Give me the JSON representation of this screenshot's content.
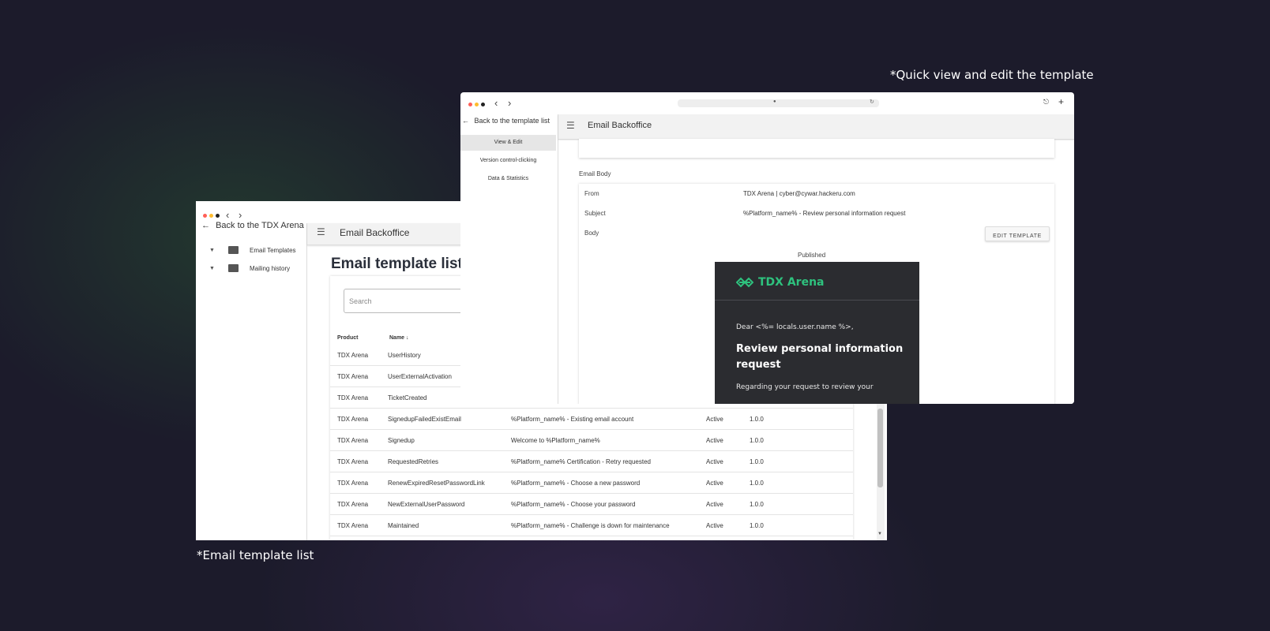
{
  "captions": {
    "quick_view": "*Quick view and edit the template",
    "template_list": "*Email template list"
  },
  "colors": {
    "background": "#1c1b2b",
    "brand_green": "#2ec27e",
    "preview_bg": "#2b2c30",
    "traffic_red": "#ff5f57",
    "traffic_yellow": "#febc2e",
    "traffic_dark": "#222222"
  },
  "list_window": {
    "back_link": "Back to the TDX Arena",
    "sidebar": [
      {
        "label": "Email Templates",
        "icon": "email-icon"
      },
      {
        "label": "Mailing history",
        "icon": "email-icon"
      }
    ],
    "appbar_title": "Email Backoffice",
    "page_title": "Email template list",
    "search_placeholder": "Search",
    "columns": {
      "product": "Product",
      "name": "Name",
      "sort_icon": "arrow-down-icon"
    },
    "rows": [
      {
        "product": "TDX Arena",
        "name": "UserHistory",
        "subject": "",
        "status": "",
        "version": ""
      },
      {
        "product": "TDX Arena",
        "name": "UserExternalActivation",
        "subject": "",
        "status": "",
        "version": ""
      },
      {
        "product": "TDX Arena",
        "name": "TicketCreated",
        "subject": "",
        "status": "",
        "version": ""
      },
      {
        "product": "TDX Arena",
        "name": "SignedupFailedExistEmail",
        "subject": "%Platform_name% - Existing email account",
        "status": "Active",
        "version": "1.0.0"
      },
      {
        "product": "TDX Arena",
        "name": "Signedup",
        "subject": "Welcome to %Platform_name%",
        "status": "Active",
        "version": "1.0.0"
      },
      {
        "product": "TDX Arena",
        "name": "RequestedRetries",
        "subject": "%Platform_name% Certification - Retry requested",
        "status": "Active",
        "version": "1.0.0"
      },
      {
        "product": "TDX Arena",
        "name": "RenewExpiredResetPasswordLink",
        "subject": "%Platform_name% - Choose a new password",
        "status": "Active",
        "version": "1.0.0"
      },
      {
        "product": "TDX Arena",
        "name": "NewExternalUserPassword",
        "subject": "%Platform_name% - Choose your password",
        "status": "Active",
        "version": "1.0.0"
      },
      {
        "product": "TDX Arena",
        "name": "Maintained",
        "subject": "%Platform_name% - Challenge is down for maintenance",
        "status": "Active",
        "version": "1.0.0"
      }
    ]
  },
  "detail_window": {
    "back_link": "Back to the template list",
    "menu": [
      "View & Edit",
      "Version control-clicking",
      "Data & Statistics"
    ],
    "appbar_title": "Email Backoffice",
    "section_label": "Email Body",
    "fields": {
      "from_label": "From",
      "from_value": "TDX Arena | cyber@cywar.hackeru.com",
      "subject_label": "Subject",
      "subject_value": "%Platform_name% - Review personal information request",
      "body_label": "Body"
    },
    "edit_button": "EDIT TEMPLATE",
    "status": "Published",
    "preview": {
      "brand": "TDX Arena",
      "greeting": "Dear <%= locals.user.name %>,",
      "headline": "Review personal information request",
      "body_start": "Regarding your request to review your"
    }
  }
}
